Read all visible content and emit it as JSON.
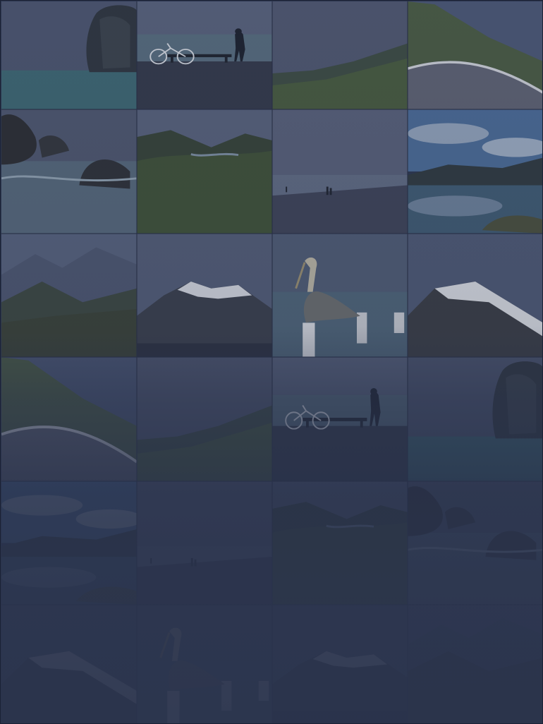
{
  "gallery": {
    "columns": 4,
    "rows": 6,
    "tiles": [
      {
        "row": 0,
        "col": 0,
        "subject": "sea-stack-rock"
      },
      {
        "row": 0,
        "col": 1,
        "subject": "person-with-bicycle-on-pier"
      },
      {
        "row": 0,
        "col": 2,
        "subject": "coastal-hill"
      },
      {
        "row": 0,
        "col": 3,
        "subject": "mountain-road"
      },
      {
        "row": 1,
        "col": 0,
        "subject": "rocky-shore-waves"
      },
      {
        "row": 1,
        "col": 1,
        "subject": "green-valley-river"
      },
      {
        "row": 1,
        "col": 2,
        "subject": "misty-beach-people"
      },
      {
        "row": 1,
        "col": 3,
        "subject": "lake-with-clouds"
      },
      {
        "row": 2,
        "col": 0,
        "subject": "mountain-range"
      },
      {
        "row": 2,
        "col": 1,
        "subject": "snowy-peak"
      },
      {
        "row": 2,
        "col": 2,
        "subject": "pelican-on-post"
      },
      {
        "row": 2,
        "col": 3,
        "subject": "snow-ridge"
      },
      {
        "row": 3,
        "col": 0,
        "subject": "mountain-road"
      },
      {
        "row": 3,
        "col": 1,
        "subject": "coastal-hill"
      },
      {
        "row": 3,
        "col": 2,
        "subject": "person-with-bicycle-on-pier"
      },
      {
        "row": 3,
        "col": 3,
        "subject": "sea-stack-rock"
      },
      {
        "row": 4,
        "col": 0,
        "subject": "lake-with-clouds"
      },
      {
        "row": 4,
        "col": 1,
        "subject": "misty-beach-people"
      },
      {
        "row": 4,
        "col": 2,
        "subject": "green-valley-river"
      },
      {
        "row": 4,
        "col": 3,
        "subject": "rocky-shore-waves"
      },
      {
        "row": 5,
        "col": 0,
        "subject": "snow-ridge"
      },
      {
        "row": 5,
        "col": 1,
        "subject": "pelican-on-post"
      },
      {
        "row": 5,
        "col": 2,
        "subject": "snowy-peak"
      },
      {
        "row": 5,
        "col": 3,
        "subject": "mountain-range"
      }
    ]
  },
  "colors": {
    "background": "#2c3650",
    "overlay": "#2a334c",
    "sky": "#4a5572",
    "sea": "#3f6a78",
    "land": "#3a4a45"
  }
}
